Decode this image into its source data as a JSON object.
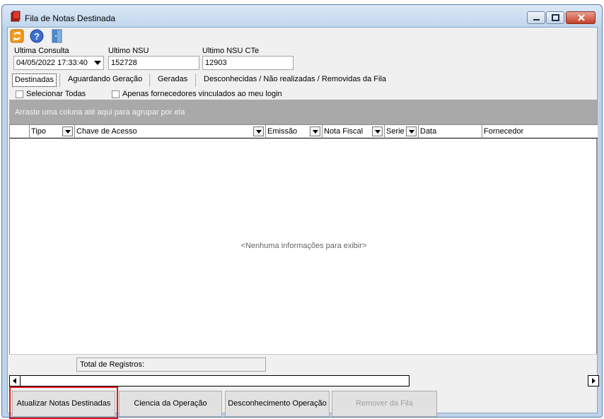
{
  "window": {
    "title": "Fila de Notas Destinada"
  },
  "toolbar": {
    "icons": [
      "refresh-icon",
      "help-icon",
      "exit-door-icon"
    ]
  },
  "fields": {
    "ultima_consulta_label": "Ultima Consulta",
    "ultima_consulta_value": "04/05/2022 17:33:40",
    "ultimo_nsu_label": "Ultimo NSU",
    "ultimo_nsu_value": "152728",
    "ultimo_nsu_cte_label": "Ultimo NSU CTe",
    "ultimo_nsu_cte_value": "12903"
  },
  "tabs": [
    "Destinadas",
    "Aguardando Geração",
    "Geradas",
    "Desconhecidas / Não realizadas / Removidas da Fila"
  ],
  "checkboxes": {
    "select_all": "Selecionar Todas",
    "only_linked": "Apenas fornecedores vinculados ao meu login"
  },
  "grid": {
    "group_hint": "Arraste uma coluna até aqui para agrupar por ela",
    "columns": [
      "Tipo",
      "Chave de Acesso",
      "Emissão",
      "Nota Fiscal",
      "Serie",
      "Data",
      "Fornecedor"
    ],
    "empty_text": "<Nenhuma informações para exibir>",
    "total_label": "Total de Registros:"
  },
  "buttons": {
    "atualizar": "Atualizar Notas Destinadas",
    "ciencia": "Ciencia da Operação",
    "desconhecimento": "Desconhecimento Operação",
    "remover": "Remover da Fila"
  },
  "colors": {
    "highlight": "#e01818",
    "group_bar": "#a9a9a9"
  }
}
